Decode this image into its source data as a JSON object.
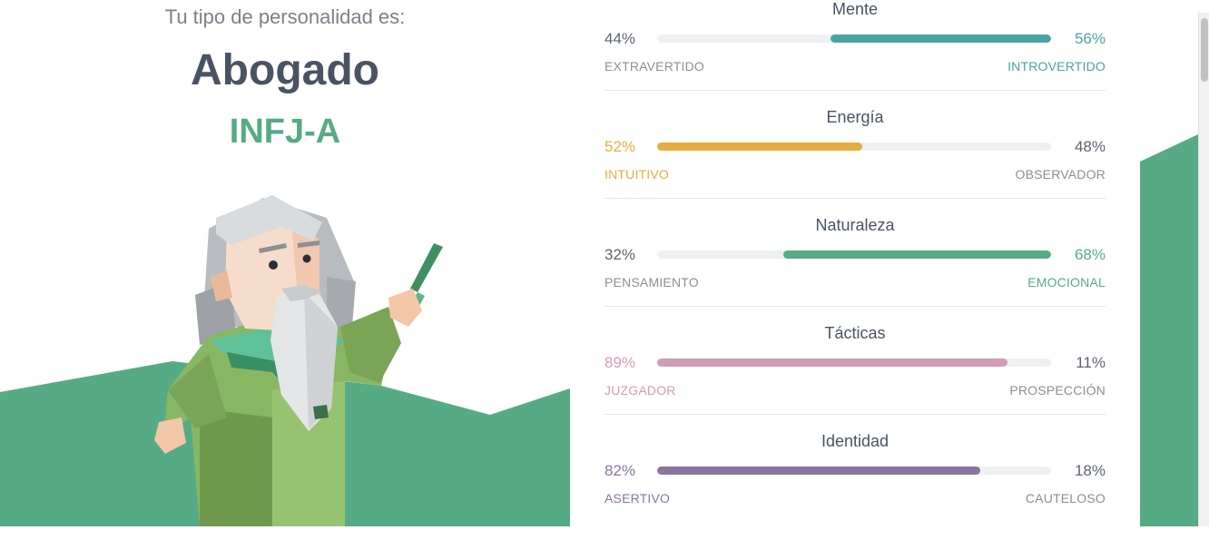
{
  "header": {
    "subtitle": "Tu tipo de personalidad es:",
    "type_name": "Abogado",
    "type_code": "INFJ-A"
  },
  "colors": {
    "green_bg": "#56ab84",
    "text_dark": "#4a5364"
  },
  "traits": [
    {
      "title": "Mente",
      "left_pct": "44%",
      "right_pct": "56%",
      "left_label": "EXTRAVERTIDO",
      "right_label": "INTROVERTIDO",
      "dominant": "right",
      "fill_percent": 56,
      "color": "#4aa3a2"
    },
    {
      "title": "Energía",
      "left_pct": "52%",
      "right_pct": "48%",
      "left_label": "INTUITIVO",
      "right_label": "OBSERVADOR",
      "dominant": "left",
      "fill_percent": 52,
      "color": "#e4ae3f"
    },
    {
      "title": "Naturaleza",
      "left_pct": "32%",
      "right_pct": "68%",
      "left_label": "PENSAMIENTO",
      "right_label": "EMOCIONAL",
      "dominant": "right",
      "fill_percent": 68,
      "color": "#56ab84"
    },
    {
      "title": "Tácticas",
      "left_pct": "89%",
      "right_pct": "11%",
      "left_label": "JUZGADOR",
      "right_label": "PROSPECCIÓN",
      "dominant": "left",
      "fill_percent": 89,
      "color": "#d29db6"
    },
    {
      "title": "Identidad",
      "left_pct": "82%",
      "right_pct": "18%",
      "left_label": "ASERTIVO",
      "right_label": "CAUTELOSO",
      "dominant": "left",
      "fill_percent": 82,
      "color": "#89759e"
    }
  ]
}
